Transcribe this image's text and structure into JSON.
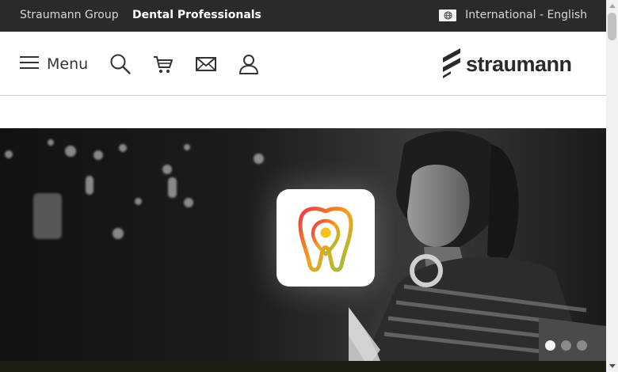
{
  "topbar": {
    "group_link": "Straumann Group",
    "professionals_link": "Dental Professionals",
    "locale": "International - English"
  },
  "header": {
    "menu_label": "Menu",
    "icons": [
      "search-icon",
      "cart-icon",
      "mail-icon",
      "user-icon"
    ],
    "logo_text": "straumann"
  },
  "hero": {
    "slides_total": 3,
    "active_slide": 1
  },
  "colors": {
    "topbar_bg": "#2a2a2a",
    "logo": "#2b2b2b",
    "app_icon_gradient": [
      "#e63946",
      "#f4a11d",
      "#8dc63f"
    ]
  }
}
